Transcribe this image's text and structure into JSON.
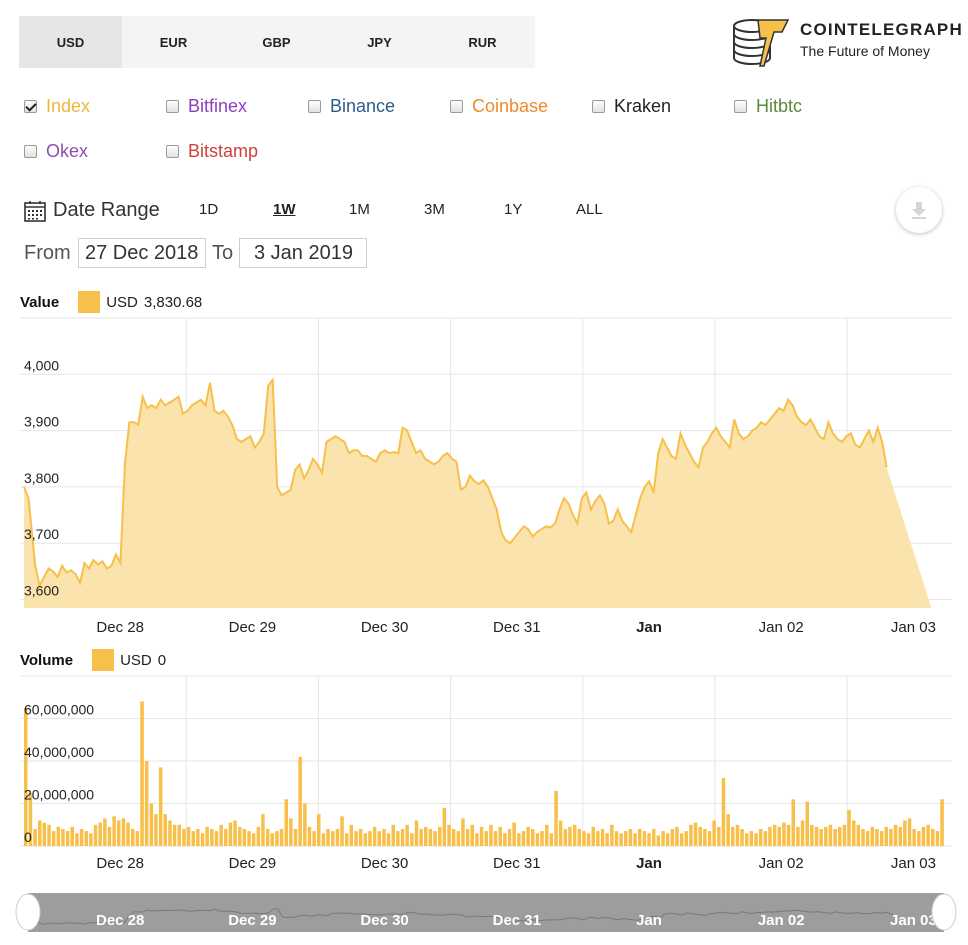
{
  "currency_tabs": [
    {
      "label": "USD",
      "active": true
    },
    {
      "label": "EUR",
      "active": false
    },
    {
      "label": "GBP",
      "active": false
    },
    {
      "label": "JPY",
      "active": false
    },
    {
      "label": "RUR",
      "active": false
    }
  ],
  "brand": {
    "name": "COINTELEGRAPH",
    "tagline": "The Future of Money",
    "color": "#f7c04a"
  },
  "exchanges": [
    {
      "label": "Index",
      "checked": true,
      "color": "#f0b43c"
    },
    {
      "label": "Bitfinex",
      "checked": false,
      "color": "#8e3fbf"
    },
    {
      "label": "Binance",
      "checked": false,
      "color": "#2c5d8a"
    },
    {
      "label": "Coinbase",
      "checked": false,
      "color": "#f08a30"
    },
    {
      "label": "Kraken",
      "checked": false,
      "color": "#222222"
    },
    {
      "label": "Hitbtc",
      "checked": false,
      "color": "#5a8a3a"
    },
    {
      "label": "Okex",
      "checked": false,
      "color": "#8e4fa8"
    },
    {
      "label": "Bitstamp",
      "checked": false,
      "color": "#d0403a"
    }
  ],
  "date_range": {
    "label": "Date Range",
    "periods": [
      {
        "label": "1D",
        "active": false
      },
      {
        "label": "1W",
        "active": true
      },
      {
        "label": "1M",
        "active": false
      },
      {
        "label": "3M",
        "active": false
      },
      {
        "label": "1Y",
        "active": false
      },
      {
        "label": "ALL",
        "active": false
      }
    ],
    "from_label": "From",
    "from_value": "27 Dec 2018",
    "to_label": "To",
    "to_value": "3 Jan 2019"
  },
  "download_icon": "download-icon",
  "value_legend": {
    "title": "Value",
    "currency": "USD",
    "value": "3,830.68"
  },
  "volume_legend": {
    "title": "Volume",
    "currency": "USD",
    "value": "0"
  },
  "chart_data": [
    {
      "type": "area",
      "title": "",
      "xlabel": "",
      "ylabel": "",
      "ylim": [
        3585,
        4100
      ],
      "y_ticks": [
        3600,
        3700,
        3800,
        3900,
        4000
      ],
      "y_tick_labels": [
        "3,600",
        "3,700",
        "3,800",
        "3,900",
        "4,000"
      ],
      "x_ticks": [
        "Dec 28",
        "Dec 29",
        "Dec 30",
        "Dec 31",
        "Jan",
        "Jan 02",
        "Jan 03"
      ],
      "grid": true,
      "color": "#f7c04a",
      "series": [
        {
          "x_days": [
            0.0,
            0.034,
            0.085,
            0.118,
            0.152,
            0.186,
            0.22,
            0.254,
            0.288,
            0.322,
            0.356,
            0.39,
            0.424,
            0.458,
            0.492,
            0.525,
            0.559,
            0.593,
            0.627,
            0.661,
            0.695,
            0.729,
            0.763,
            0.797,
            0.831,
            0.864,
            0.898,
            0.932,
            0.966,
            1.0,
            1.034,
            1.068,
            1.102,
            1.136,
            1.169,
            1.203,
            1.237,
            1.271,
            1.305,
            1.339,
            1.373,
            1.407,
            1.441,
            1.475,
            1.508,
            1.542,
            1.576,
            1.61,
            1.644,
            1.678,
            1.712,
            1.746,
            1.78,
            1.814,
            1.847,
            1.881,
            1.915,
            1.949,
            1.983,
            2.017,
            2.051,
            2.085,
            2.119,
            2.153,
            2.186,
            2.22,
            2.254,
            2.288,
            2.322,
            2.356,
            2.39,
            2.424,
            2.458,
            2.492,
            2.525,
            2.559,
            2.593,
            2.627,
            2.661,
            2.695,
            2.729,
            2.763,
            2.797,
            2.831,
            2.864,
            2.898,
            2.932,
            2.966,
            3.0,
            3.034,
            3.068,
            3.102,
            3.136,
            3.169,
            3.203,
            3.237,
            3.271,
            3.305,
            3.339,
            3.373,
            3.407,
            3.441,
            3.475,
            3.508,
            3.542,
            3.576,
            3.61,
            3.644,
            3.678,
            3.712,
            3.746,
            3.78,
            3.814,
            3.847,
            3.881,
            3.915,
            3.949,
            3.983,
            4.017,
            4.051,
            4.085,
            4.119,
            4.153,
            4.186,
            4.22,
            4.254,
            4.288,
            4.322,
            4.356,
            4.39,
            4.424,
            4.458,
            4.492,
            4.525,
            4.559,
            4.593,
            4.627,
            4.661,
            4.695,
            4.729,
            4.763,
            4.797,
            4.831,
            4.864,
            4.898,
            4.932,
            4.966,
            5.0,
            5.034,
            5.068,
            5.102,
            5.136,
            5.169,
            5.203,
            5.237,
            5.271,
            5.305,
            5.339,
            5.373,
            5.407,
            5.441,
            5.475,
            5.508,
            5.542,
            5.576,
            5.61,
            5.644,
            5.678,
            5.712,
            5.746,
            5.78,
            5.814,
            5.847,
            5.881,
            5.915,
            5.949,
            5.983,
            6.017,
            6.051,
            6.085,
            6.119,
            6.153,
            6.186,
            6.22,
            6.254,
            6.288,
            6.322,
            6.356,
            6.39,
            6.424,
            6.458,
            6.492,
            6.525,
            6.559,
            6.593,
            6.627,
            6.661,
            6.695,
            6.729,
            6.763,
            6.797,
            6.831,
            6.864
          ],
          "values": [
            3800,
            3780,
            3660,
            3625,
            3640,
            3655,
            3650,
            3640,
            3660,
            3648,
            3652,
            3645,
            3630,
            3665,
            3655,
            3670,
            3662,
            3668,
            3655,
            3660,
            3680,
            3665,
            3840,
            3915,
            3915,
            3910,
            3960,
            3940,
            3945,
            3940,
            3955,
            3945,
            3950,
            3955,
            3960,
            3930,
            3935,
            3945,
            3950,
            3955,
            3945,
            3985,
            3935,
            3930,
            3935,
            3925,
            3910,
            3885,
            3880,
            3885,
            3890,
            3870,
            3880,
            3895,
            3980,
            3990,
            3800,
            3785,
            3790,
            3795,
            3830,
            3840,
            3815,
            3830,
            3850,
            3840,
            3825,
            3880,
            3885,
            3890,
            3885,
            3880,
            3860,
            3865,
            3865,
            3855,
            3855,
            3850,
            3845,
            3860,
            3865,
            3860,
            3862,
            3860,
            3905,
            3900,
            3880,
            3860,
            3865,
            3850,
            3845,
            3840,
            3845,
            3855,
            3860,
            3850,
            3845,
            3795,
            3800,
            3820,
            3810,
            3805,
            3812,
            3800,
            3780,
            3760,
            3720,
            3705,
            3700,
            3710,
            3720,
            3730,
            3725,
            3712,
            3720,
            3725,
            3730,
            3728,
            3735,
            3760,
            3780,
            3770,
            3750,
            3735,
            3780,
            3790,
            3760,
            3775,
            3785,
            3770,
            3735,
            3740,
            3760,
            3740,
            3730,
            3720,
            3750,
            3780,
            3800,
            3810,
            3790,
            3860,
            3885,
            3870,
            3855,
            3850,
            3895,
            3875,
            3860,
            3845,
            3835,
            3870,
            3880,
            3895,
            3905,
            3890,
            3880,
            3870,
            3920,
            3895,
            3885,
            3890,
            3900,
            3905,
            3915,
            3910,
            3920,
            3930,
            3940,
            3935,
            3955,
            3945,
            3925,
            3915,
            3910,
            3920,
            3905,
            3890,
            3885,
            3915,
            3895,
            3885,
            3880,
            3890,
            3895,
            3875,
            3870,
            3885,
            3900,
            3880,
            3905,
            3880,
            3835
          ]
        }
      ]
    },
    {
      "type": "bar",
      "title": "",
      "xlabel": "",
      "ylabel": "",
      "ylim": [
        0,
        80000000
      ],
      "y_ticks": [
        0,
        20000000,
        40000000,
        60000000
      ],
      "y_tick_labels": [
        "0",
        "20,000,000",
        "40,000,000",
        "60,000,000"
      ],
      "x_ticks": [
        "Dec 28",
        "Dec 29",
        "Dec 30",
        "Dec 31",
        "Jan",
        "Jan 02",
        "Jan 03"
      ],
      "grid": true,
      "color": "#f7c04a",
      "series": [
        {
          "values": [
            65000000,
            25000000,
            8000000,
            12000000,
            11000000,
            10000000,
            7000000,
            9000000,
            8000000,
            7000000,
            9000000,
            6000000,
            8000000,
            7000000,
            6000000,
            10000000,
            11000000,
            13000000,
            9000000,
            14000000,
            12000000,
            13000000,
            11000000,
            8000000,
            7000000,
            68000000,
            40000000,
            20000000,
            15000000,
            37000000,
            15000000,
            12000000,
            10000000,
            10000000,
            8000000,
            9000000,
            7000000,
            8000000,
            6000000,
            9000000,
            8000000,
            7000000,
            10000000,
            8000000,
            11000000,
            12000000,
            9000000,
            8000000,
            7000000,
            6000000,
            9000000,
            15000000,
            8000000,
            6000000,
            7000000,
            8000000,
            22000000,
            13000000,
            8000000,
            42000000,
            20000000,
            9000000,
            7000000,
            15000000,
            6000000,
            8000000,
            7000000,
            8000000,
            14000000,
            6000000,
            10000000,
            7000000,
            8000000,
            6000000,
            7000000,
            9000000,
            7000000,
            8000000,
            6000000,
            10000000,
            7000000,
            8000000,
            10000000,
            6000000,
            12000000,
            8000000,
            9000000,
            8000000,
            7000000,
            9000000,
            18000000,
            10000000,
            8000000,
            7000000,
            13000000,
            8000000,
            10000000,
            6000000,
            9000000,
            7000000,
            10000000,
            7000000,
            9000000,
            6000000,
            8000000,
            11000000,
            6000000,
            7000000,
            9000000,
            8000000,
            6000000,
            7000000,
            10000000,
            6000000,
            26000000,
            12000000,
            8000000,
            9000000,
            10000000,
            8000000,
            7000000,
            6000000,
            9000000,
            7000000,
            8000000,
            6000000,
            10000000,
            7000000,
            6000000,
            7000000,
            8000000,
            6000000,
            8000000,
            7000000,
            6000000,
            8000000,
            5000000,
            7000000,
            6000000,
            8000000,
            9000000,
            6000000,
            7000000,
            10000000,
            11000000,
            9000000,
            8000000,
            7000000,
            12000000,
            9000000,
            32000000,
            15000000,
            9000000,
            10000000,
            8000000,
            6000000,
            7000000,
            6000000,
            8000000,
            7000000,
            9000000,
            10000000,
            9000000,
            11000000,
            10000000,
            22000000,
            9000000,
            12000000,
            21000000,
            10000000,
            9000000,
            8000000,
            9000000,
            10000000,
            8000000,
            9000000,
            10000000,
            17000000,
            12000000,
            10000000,
            8000000,
            7000000,
            9000000,
            8000000,
            7000000,
            9000000,
            8000000,
            10000000,
            9000000,
            12000000,
            13000000,
            8000000,
            7000000,
            9000000,
            10000000,
            8000000,
            7000000,
            22000000
          ]
        }
      ]
    }
  ],
  "navigator": {
    "x_ticks": [
      "Dec 28",
      "Dec 29",
      "Dec 30",
      "Dec 31",
      "Jan",
      "Jan 02",
      "Jan 03"
    ]
  }
}
